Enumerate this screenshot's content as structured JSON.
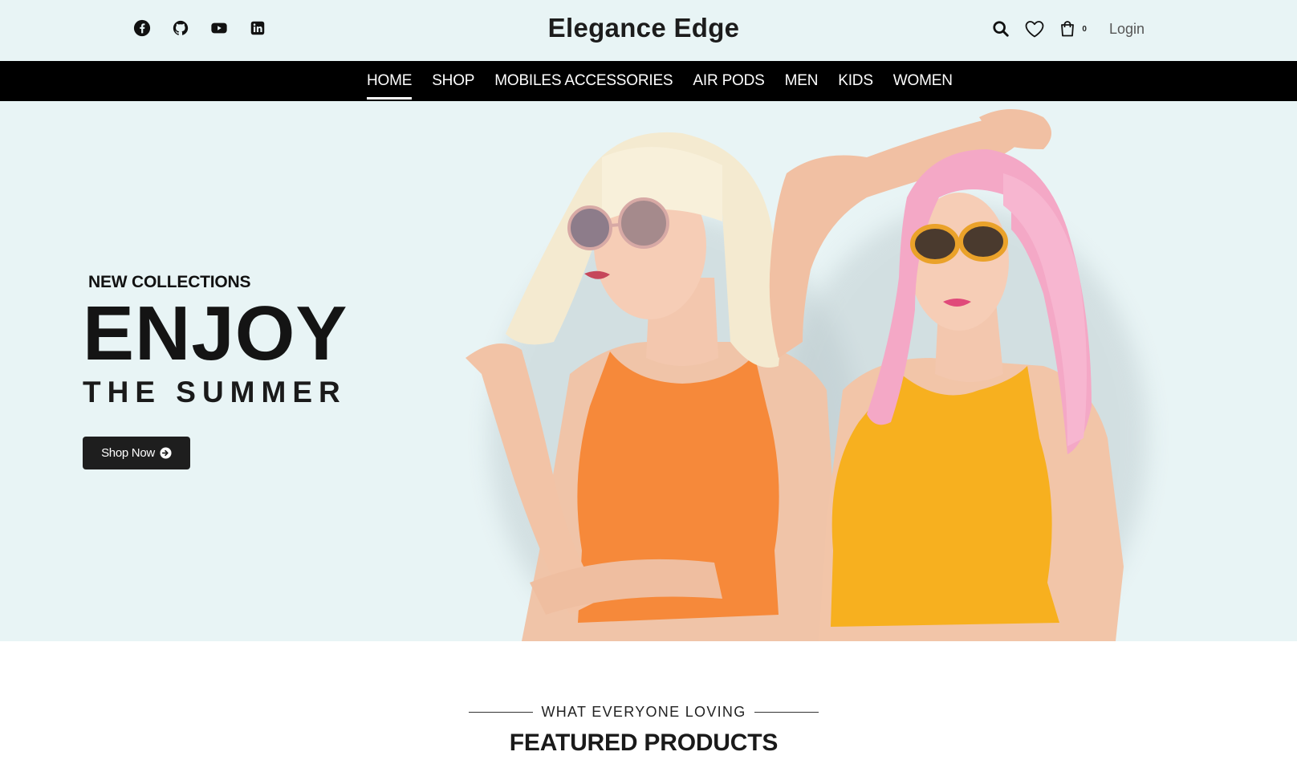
{
  "brand": {
    "name": "Elegance Edge"
  },
  "social": [
    {
      "name": "facebook-icon"
    },
    {
      "name": "github-icon"
    },
    {
      "name": "youtube-icon"
    },
    {
      "name": "linkedin-icon"
    }
  ],
  "header": {
    "cart_count": "0",
    "login_label": "Login",
    "icons": [
      "search-icon",
      "heart-icon",
      "cart-icon"
    ]
  },
  "nav": {
    "items": [
      {
        "label": "HOME",
        "active": true
      },
      {
        "label": "SHOP",
        "active": false
      },
      {
        "label": "MOBILES ACCESSORIES",
        "active": false
      },
      {
        "label": "AIR PODS",
        "active": false
      },
      {
        "label": "MEN",
        "active": false
      },
      {
        "label": "KIDS",
        "active": false
      },
      {
        "label": "WOMEN",
        "active": false
      }
    ]
  },
  "hero": {
    "subtitle": "NEW COLLECTIONS",
    "headline": "ENJOY",
    "tagline": "THE SUMMER",
    "cta_label": "Shop Now",
    "background": "#e8f4f5"
  },
  "featured": {
    "eyebrow": "WHAT EVERYONE LOVING",
    "title": "FEATURED PRODUCTS"
  },
  "colors": {
    "topbar_bg": "#e8f4f5",
    "nav_bg": "#000000",
    "button_bg": "#1e1e1e"
  }
}
